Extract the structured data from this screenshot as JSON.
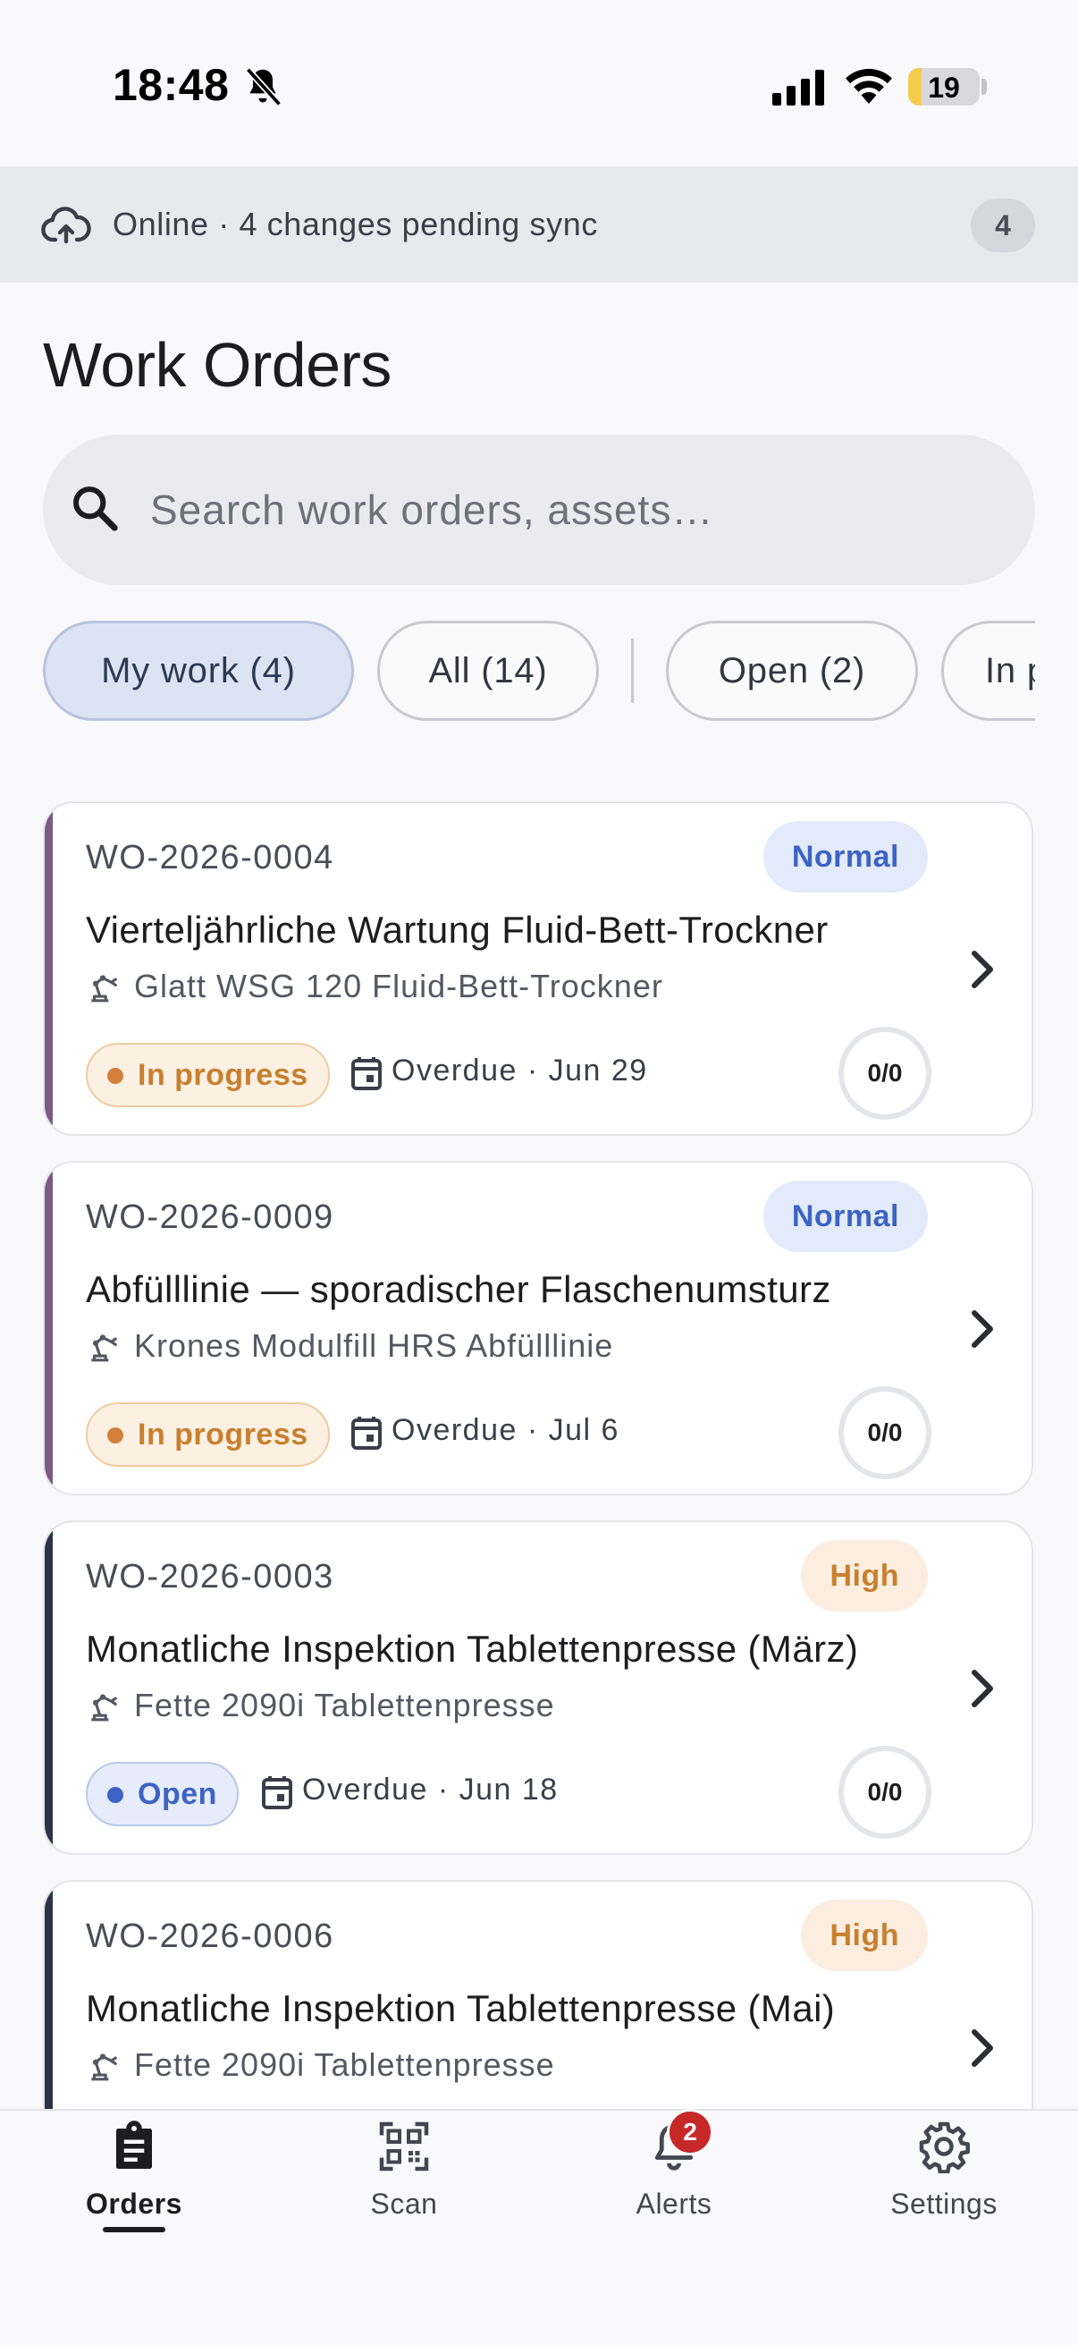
{
  "status_bar": {
    "time": "18:48",
    "battery_level": "19",
    "battery_fraction": 0.19
  },
  "sync_banner": {
    "text": "Online · 4 changes pending sync",
    "count": "4"
  },
  "page_title": "Work Orders",
  "search": {
    "placeholder": "Search work orders, assets…",
    "value": ""
  },
  "filters": [
    {
      "label": "My work (4)",
      "active": true
    },
    {
      "label": "All (14)",
      "active": false
    },
    {
      "label": "Open (2)",
      "active": false
    },
    {
      "label": "In p",
      "active": false
    }
  ],
  "work_orders": [
    {
      "id": "WO-2026-0004",
      "priority": "Normal",
      "title": "Vierteljährliche Wartung Fluid-Bett-Trockner",
      "asset": "Glatt WSG 120 Fluid-Bett-Trockner",
      "status": "In progress",
      "due": "Overdue · Jun 29",
      "progress": "0/0",
      "accent_color": "#7b5a86"
    },
    {
      "id": "WO-2026-0009",
      "priority": "Normal",
      "title": "Abfülllinie — sporadischer Flaschenumsturz",
      "asset": "Krones Modulfill HRS Abfülllinie",
      "status": "In progress",
      "due": "Overdue · Jul 6",
      "progress": "0/0",
      "accent_color": "#7b5a86"
    },
    {
      "id": "WO-2026-0003",
      "priority": "High",
      "title": "Monatliche Inspektion Tablettenpresse (März)",
      "asset": "Fette 2090i Tablettenpresse",
      "status": "Open",
      "due": "Overdue · Jun 18",
      "progress": "0/0",
      "accent_color": "#2b3444"
    },
    {
      "id": "WO-2026-0006",
      "priority": "High",
      "title": "Monatliche Inspektion Tablettenpresse (Mai)",
      "asset": "Fette 2090i Tablettenpresse",
      "accent_color": "#2b3444"
    }
  ],
  "bottom_nav": [
    {
      "label": "Orders",
      "icon": "clipboard-icon",
      "active": true
    },
    {
      "label": "Scan",
      "icon": "qr-code-icon",
      "active": false
    },
    {
      "label": "Alerts",
      "icon": "bell-icon",
      "active": false,
      "badge": "2"
    },
    {
      "label": "Settings",
      "icon": "gear-icon",
      "active": false
    }
  ],
  "colors": {
    "accent_blue": "#3d63c4",
    "accent_orange": "#c8802f",
    "alert_red": "#c62828"
  }
}
